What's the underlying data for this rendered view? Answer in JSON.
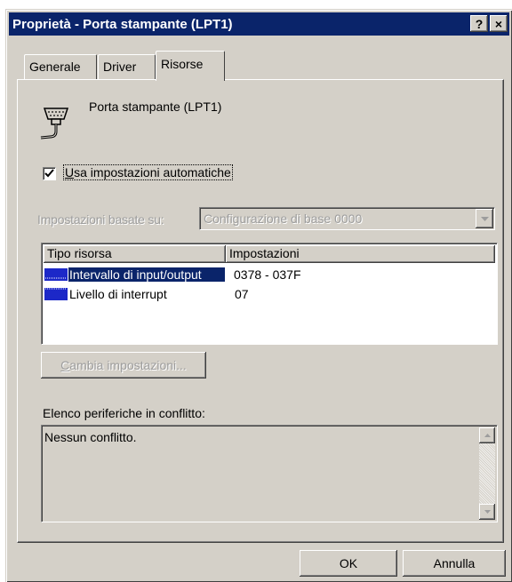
{
  "window": {
    "title": "Proprietà - Porta stampante (LPT1)",
    "help_label": "?",
    "close_label": "×"
  },
  "tabs": [
    {
      "label": "Generale",
      "active": false
    },
    {
      "label": "Driver",
      "active": false
    },
    {
      "label": "Risorse",
      "active": true
    }
  ],
  "device": {
    "name": "Porta stampante (LPT1)",
    "icon": "printer-port-icon"
  },
  "auto_settings": {
    "checked": true,
    "mnemonic": "U",
    "rest": "sa impostazioni automatiche"
  },
  "based_on": {
    "label": "Impostazioni basate su:",
    "selected": "Configurazione di base 0000",
    "enabled": false
  },
  "resources": {
    "columns": [
      "Tipo risorsa",
      "Impostazioni"
    ],
    "rows": [
      {
        "type": "Intervallo di input/output",
        "setting": "0378 - 037F",
        "selected": true
      },
      {
        "type": "Livello di interrupt",
        "setting": "07",
        "selected": false
      }
    ]
  },
  "change_button": {
    "mnemonic": "C",
    "rest": "ambia impostazioni...",
    "enabled": false
  },
  "conflicts": {
    "label": "Elenco periferiche in conflitto:",
    "text": "Nessun conflitto."
  },
  "footer": {
    "ok_label": "OK",
    "cancel_label": "Annulla"
  },
  "colors": {
    "titlebar": "#0a246a",
    "face": "#d4d0c8",
    "disabled_text": "#9d9d9d",
    "resource_icon": "#1c28c8"
  }
}
